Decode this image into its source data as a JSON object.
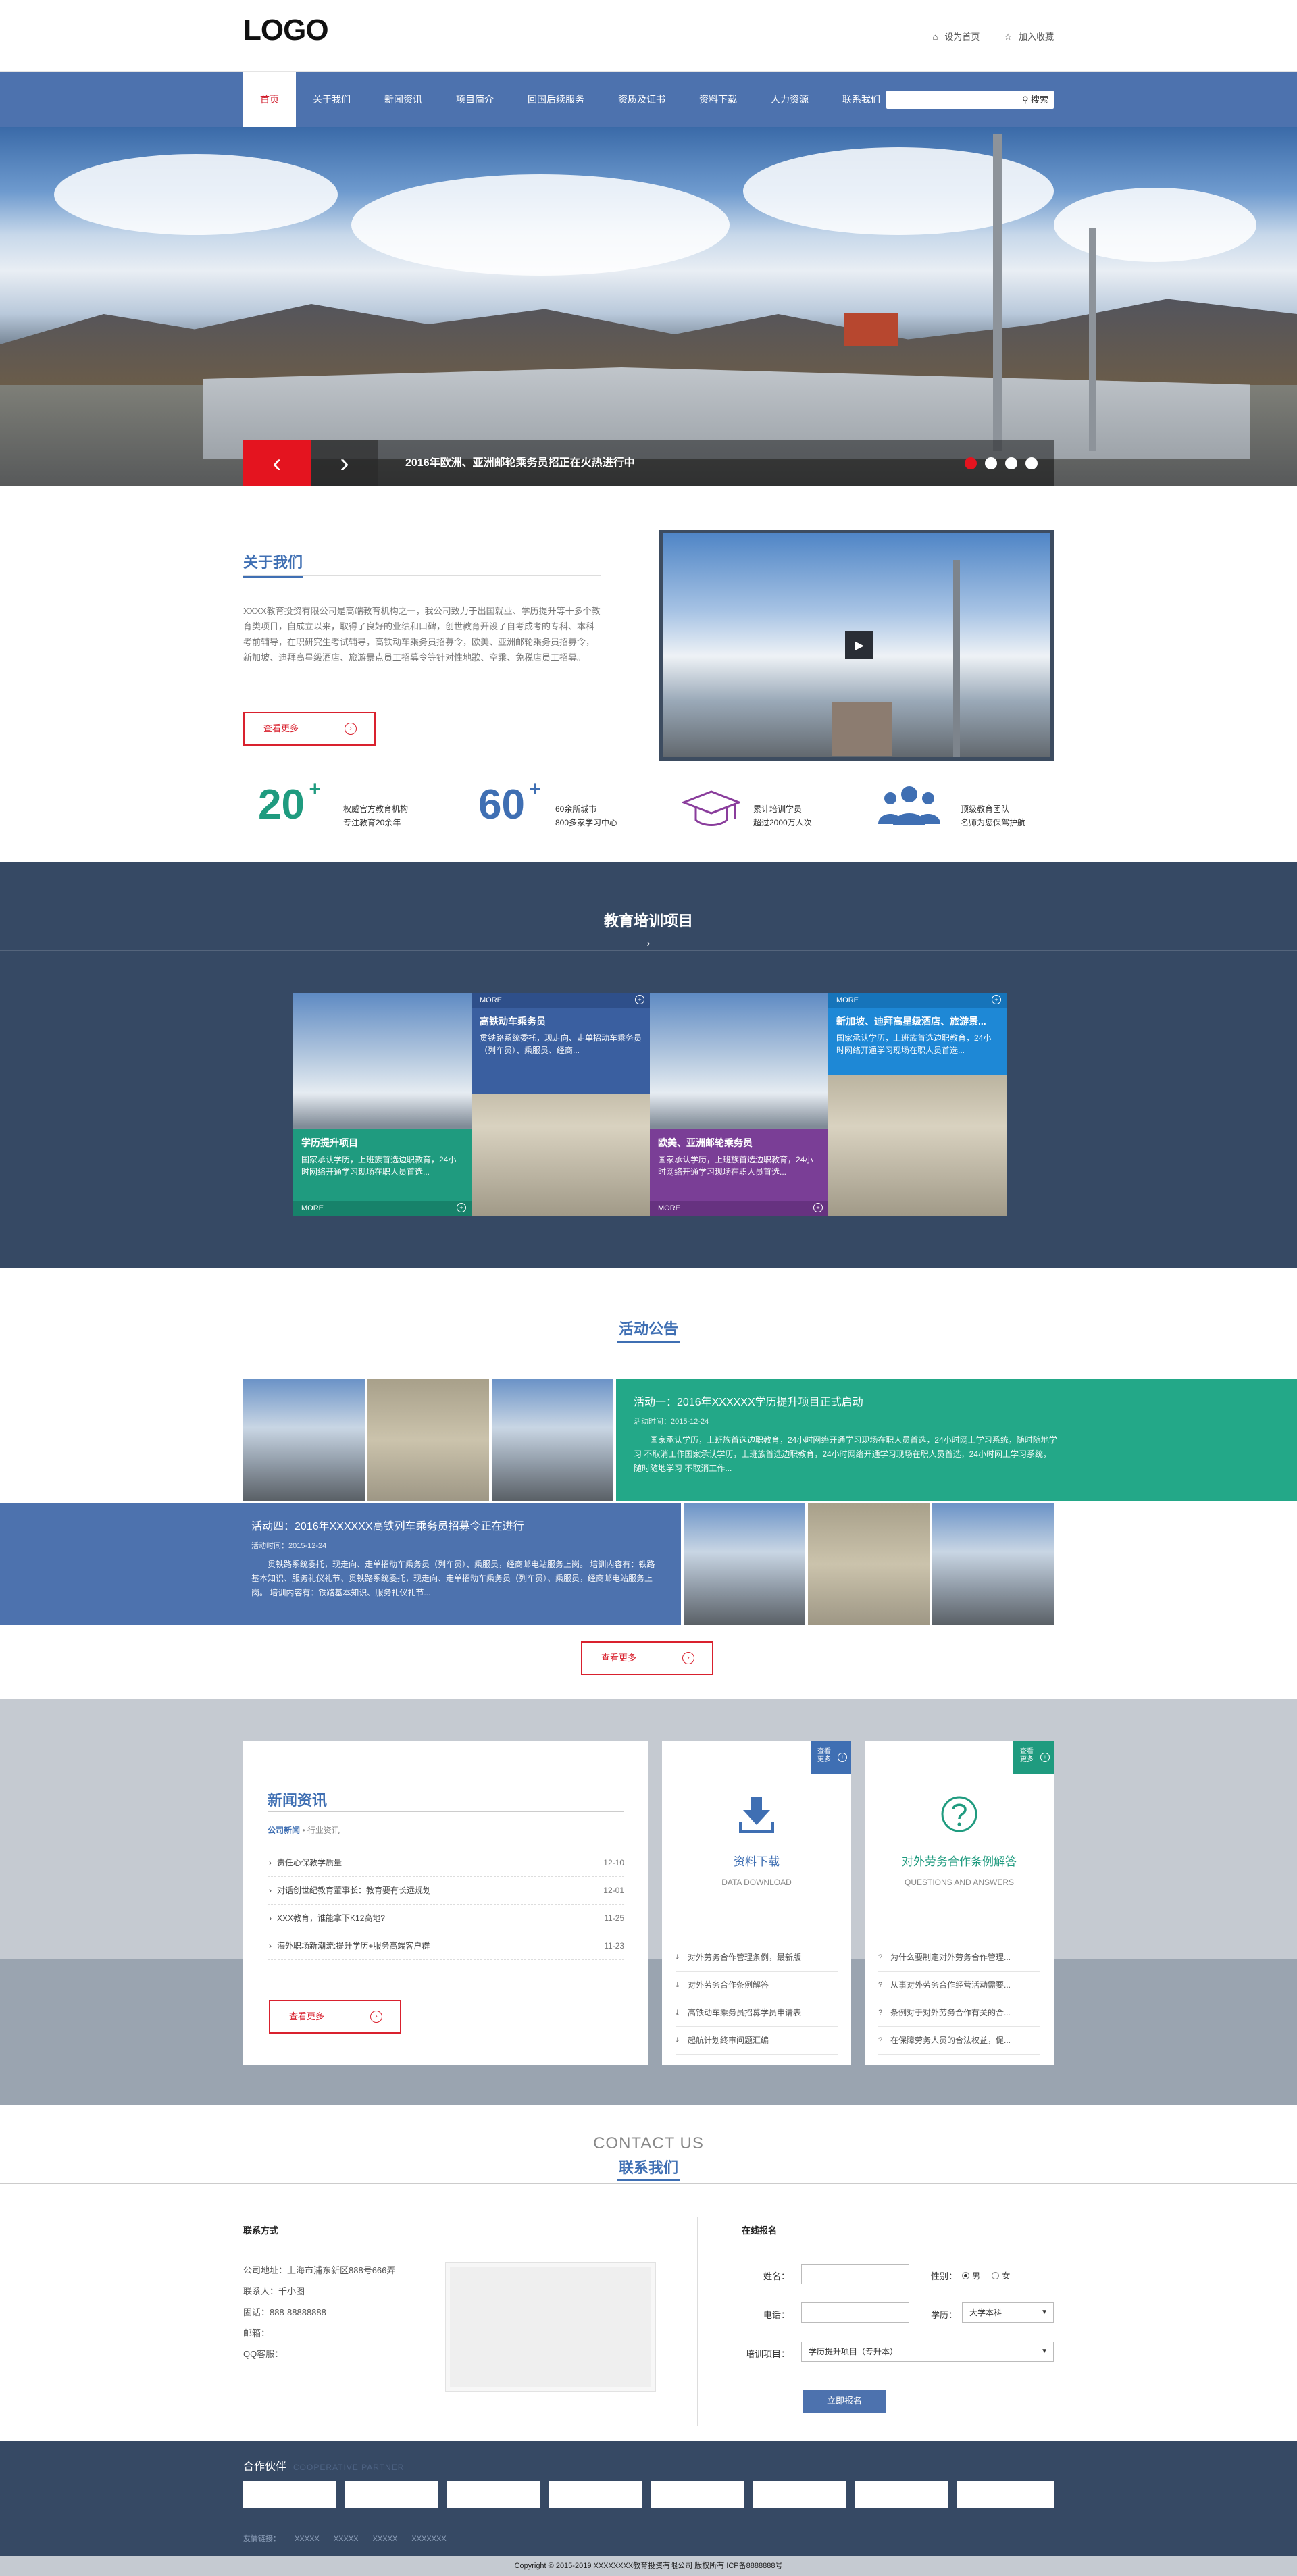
{
  "header": {
    "logo": "LOGO",
    "set_home": "设为首页",
    "add_favorite": "加入收藏"
  },
  "nav": {
    "items": [
      "首页",
      "关于我们",
      "新闻资讯",
      "项目简介",
      "回国后续服务",
      "资质及证书",
      "资料下载",
      "人力资源",
      "联系我们"
    ],
    "active": "首页",
    "search_placeholder": "",
    "search_button": "搜索"
  },
  "banner": {
    "caption": "2016年欧洲、亚洲邮轮乘务员招正在火热进行中",
    "slide_count": 4,
    "current_slide": 1
  },
  "about": {
    "title": "关于我们",
    "text": "XXXX教育投资有限公司是高端教育机构之一，我公司致力于出国就业、学历提升等十多个教育类项目，自成立以来，取得了良好的业绩和口碑，创世教育开设了自考成考的专科、本科考前辅导，在职研究生考试辅导，高铁动车乘务员招募令，欧美、亚洲邮轮乘务员招募令，新加坡、迪拜高星级酒店、旅游景点员工招募令等针对性地歌、空乘、免税店员工招募。",
    "more": "查看更多"
  },
  "stats": [
    {
      "num": "20",
      "sup": "+",
      "line1": "权威官方教育机构",
      "line2": "专注教育20余年",
      "color": "#1f9b7f"
    },
    {
      "num": "60",
      "sup": "+",
      "line1": "60余所城市",
      "line2": "800多家学习中心",
      "color": "#3f6fb3"
    },
    {
      "icon": "graduation-cap-icon",
      "line1": "累计培训学员",
      "line2": "超过2000万人次",
      "color": "#8a3d9c"
    },
    {
      "icon": "team-icon",
      "line1": "顶级教育团队",
      "line2": "名师为您保驾护航",
      "color": "#3f6fb3"
    }
  ],
  "projects": {
    "title": "教育培训项目",
    "cards": [
      {
        "title": "学历提升项目",
        "desc": "国家承认学历，上班族首选边职教育，24小时网络开通学习现场在职人员首选...",
        "more": "MORE",
        "color": "#1f9b7f",
        "position": "bottom"
      },
      {
        "title": "高铁动车乘务员",
        "desc": "贯铁路系统委托，现走向、走单招动车乘务员（列车员）、乘服员、经商...",
        "more": "MORE",
        "color": "#3a5fa0",
        "position": "top"
      },
      {
        "title": "欧美、亚洲邮轮乘务员",
        "desc": "国家承认学历，上班族首选边职教育，24小时网络开通学习现场在职人员首选...",
        "more": "MORE",
        "color": "#7a3e96",
        "position": "bottom"
      },
      {
        "title": "新加坡、迪拜高星级酒店、旅游景...",
        "desc": "国家承认学历，上班族首选边职教育，24小时网络开通学习现场在职人员首选...",
        "more": "MORE",
        "color": "#1e88d6",
        "position": "top"
      }
    ]
  },
  "announcements": {
    "title": "活动公告",
    "items": [
      {
        "title": "活动一：2016年XXXXXX学历提升项目正式启动",
        "date": "活动时间：2015-12-24",
        "desc": "国家承认学历，上班族首选边职教育，24小时网络开通学习现场在职人员首选，24小时网上学习系统，随时随地学习 不取消工作国家承认学历，上班族首选边职教育，24小时网络开通学习现场在职人员首选，24小时网上学习系统，随时随地学习 不取消工作..."
      },
      {
        "title": "活动四：2016年XXXXXX高铁列车乘务员招募令正在进行",
        "date": "活动时间：2015-12-24",
        "desc": "贯铁路系统委托，现走向、走单招动车乘务员（列车员）、乘服员，经商邮电站服务上岗。 培训内容有：铁路基本知识、服务礼仪礼节、贯铁路系统委托，现走向、走单招动车乘务员（列车员）、乘服员，经商邮电站服务上岗。 培训内容有：铁路基本知识、服务礼仪礼节..."
      }
    ],
    "more": "查看更多"
  },
  "news": {
    "title": "新闻资讯",
    "tab_active": "公司新闻",
    "tab_sep": "•",
    "tab_other": "行业资讯",
    "items": [
      {
        "title": "责任心保教学质量",
        "date": "12-10"
      },
      {
        "title": "对话创世纪教育董事长：教育要有长远规划",
        "date": "12-01"
      },
      {
        "title": "XXX教育，谁能拿下K12高地?",
        "date": "11-25"
      },
      {
        "title": "海外职场新潮流:提升学历+服务高端客户群",
        "date": "11-23"
      }
    ],
    "more": "查看更多"
  },
  "downloads": {
    "corner": [
      "查看",
      "更多"
    ],
    "title": "资料下载",
    "subtitle": "DATA DOWNLOAD",
    "items": [
      "对外劳务合作管理条例，最新版",
      "对外劳务合作条例解答",
      "高铁动车乘务员招募学员申请表",
      "起航计划终审问题汇编"
    ]
  },
  "faq": {
    "corner": [
      "查看",
      "更多"
    ],
    "title": "对外劳务合作条例解答",
    "subtitle": "QUESTIONS AND ANSWERS",
    "items": [
      "为什么要制定对外劳务合作管理...",
      "从事对外劳务合作经营活动需要...",
      "条例对于对外劳务合作有关的合...",
      "在保障劳务人员的合法权益，促..."
    ]
  },
  "contact": {
    "title_en": "CONTACT US",
    "title_cn": "联系我们",
    "info_title": "联系方式",
    "info": [
      "公司地址：上海市浦东新区888号666弄",
      "联系人：千小图",
      "固话：888-88888888",
      "邮箱：",
      "QQ客服："
    ],
    "form_title": "在线报名",
    "name_label": "姓名：",
    "name_value": "",
    "gender_label": "性别：",
    "gender_options": [
      "男",
      "女"
    ],
    "gender_selected": "男",
    "phone_label": "电话：",
    "phone_value": "",
    "edu_label": "学历：",
    "edu_value": "大学本科",
    "project_label": "培训项目：",
    "project_value": "学历提升项目（专升本）",
    "submit": "立即报名"
  },
  "footer": {
    "partners_title": "合作伙伴",
    "partners_en": "COOPERATIVE PARTNER",
    "partner_count": 8,
    "links_label": "友情链接：",
    "links": [
      "XXXXX",
      "XXXXX",
      "XXXXX",
      "XXXXXXX"
    ],
    "copyright": "Copyright © 2015-2019 XXXXXXXX教育投资有限公司 版权所有 ICP备8888888号"
  }
}
